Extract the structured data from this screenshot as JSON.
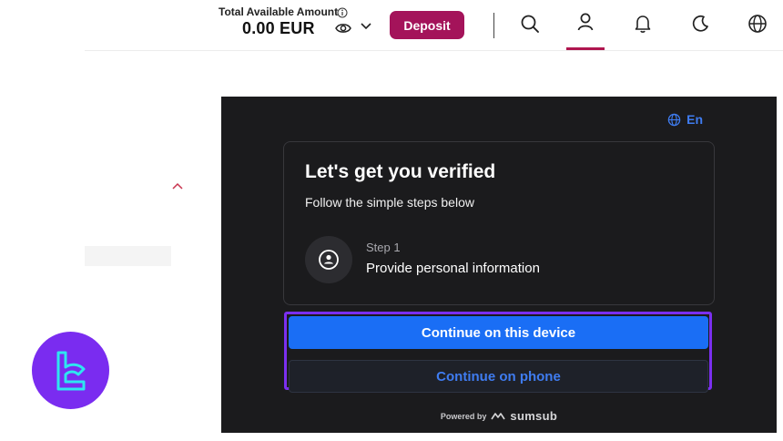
{
  "header": {
    "balance_label": "Total Available Amount",
    "balance_value": "0.00 EUR",
    "deposit_label": "Deposit",
    "icons": [
      "info-icon",
      "eye-icon",
      "chevron-down-icon",
      "search-icon",
      "user-icon",
      "bell-icon",
      "moon-icon",
      "globe-icon"
    ]
  },
  "verification": {
    "language": "En",
    "title": "Let's get you verified",
    "subtitle": "Follow the simple steps below",
    "step_number": "Step 1",
    "step_text": "Provide personal information",
    "continue_device": "Continue on this device",
    "continue_phone": "Continue on phone",
    "powered_by": "Powered by",
    "brand": "sumsub"
  },
  "colors": {
    "deposit": "#a4135a",
    "panel_bg": "#1b1b1d",
    "primary_button": "#1a6ef5",
    "highlight": "#7b2ff0",
    "link_blue": "#3f7cf0"
  }
}
